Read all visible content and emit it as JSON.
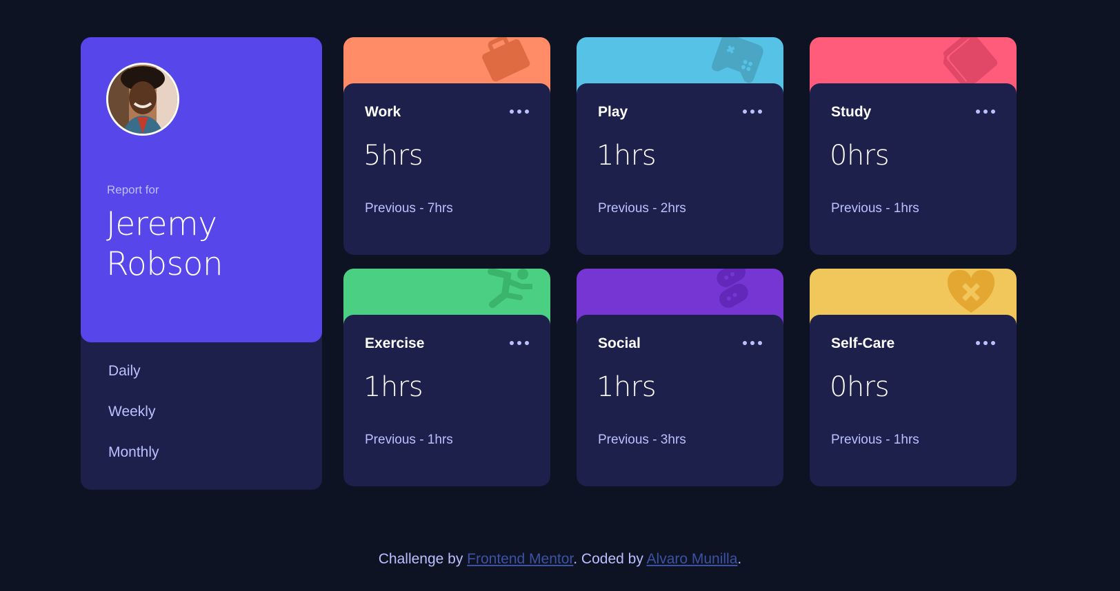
{
  "profile": {
    "report_label": "Report for",
    "name": "Jeremy Robson",
    "avatar_alt": "Jeremy Robson"
  },
  "timeframes": [
    {
      "label": "Daily"
    },
    {
      "label": "Weekly"
    },
    {
      "label": "Monthly"
    }
  ],
  "activities": [
    {
      "title": "Work",
      "hours": "5hrs",
      "previous": "Previous - 7hrs",
      "color": "#ff8c66",
      "icon": "work-briefcase-icon"
    },
    {
      "title": "Play",
      "hours": "1hrs",
      "previous": "Previous - 2hrs",
      "color": "#56c2e6",
      "icon": "play-gamepad-icon"
    },
    {
      "title": "Study",
      "hours": "0hrs",
      "previous": "Previous - 1hrs",
      "color": "#ff5c7c",
      "icon": "study-book-icon"
    },
    {
      "title": "Exercise",
      "hours": "1hrs",
      "previous": "Previous - 1hrs",
      "color": "#4bcf83",
      "icon": "exercise-runner-icon"
    },
    {
      "title": "Social",
      "hours": "1hrs",
      "previous": "Previous - 3hrs",
      "color": "#7536d3",
      "icon": "social-chat-icon"
    },
    {
      "title": "Self-Care",
      "hours": "0hrs",
      "previous": "Previous - 1hrs",
      "color": "#f1c65b",
      "icon": "self-care-heart-icon"
    }
  ],
  "footer": {
    "prefix": "Challenge by ",
    "link1": "Frontend Mentor",
    "middle": ". Coded by ",
    "link2": "Alvaro Munilla",
    "suffix": "."
  }
}
